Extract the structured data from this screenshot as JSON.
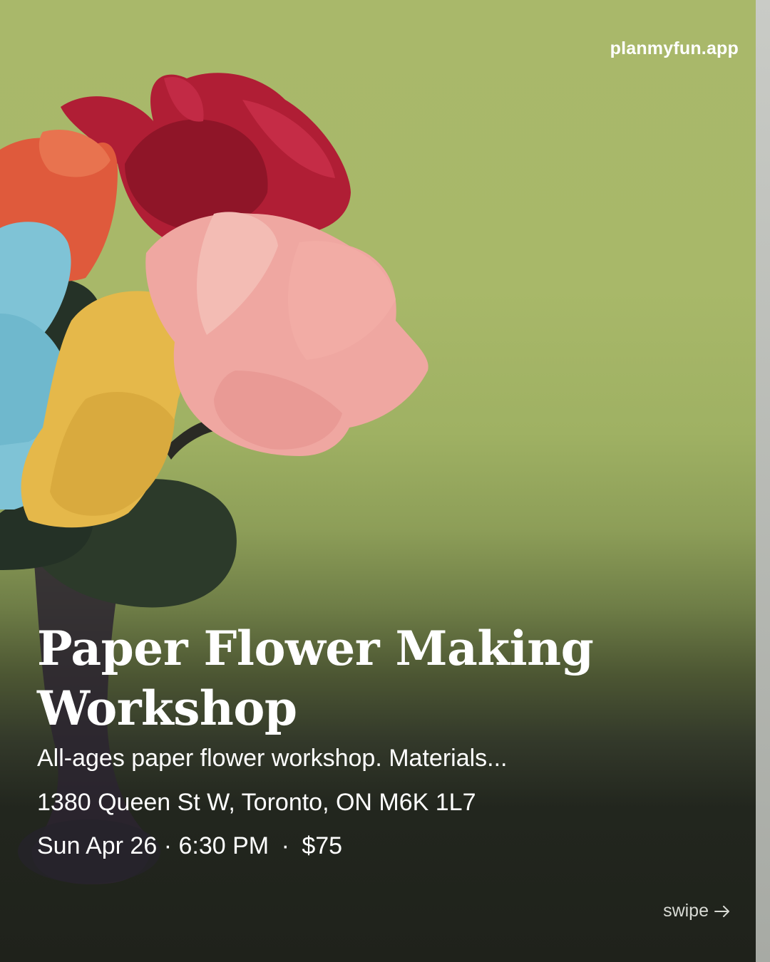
{
  "brand": "planmyfun.app",
  "event": {
    "title_line1": "Paper Flower Making",
    "title_line2": "Workshop",
    "description": "All-ages paper flower workshop. Materials...",
    "address": "1380 Queen St W, Toronto, ON M6K 1L7",
    "date": "Sun Apr 26",
    "time": "6:30 PM",
    "price": "$75",
    "separator": "·"
  },
  "swipe_label": "swipe",
  "swipe_icon": "arrow-right-icon",
  "colors": {
    "background_top": "#a9b86a",
    "background_bottom": "#1f221b",
    "text": "#ffffff"
  }
}
